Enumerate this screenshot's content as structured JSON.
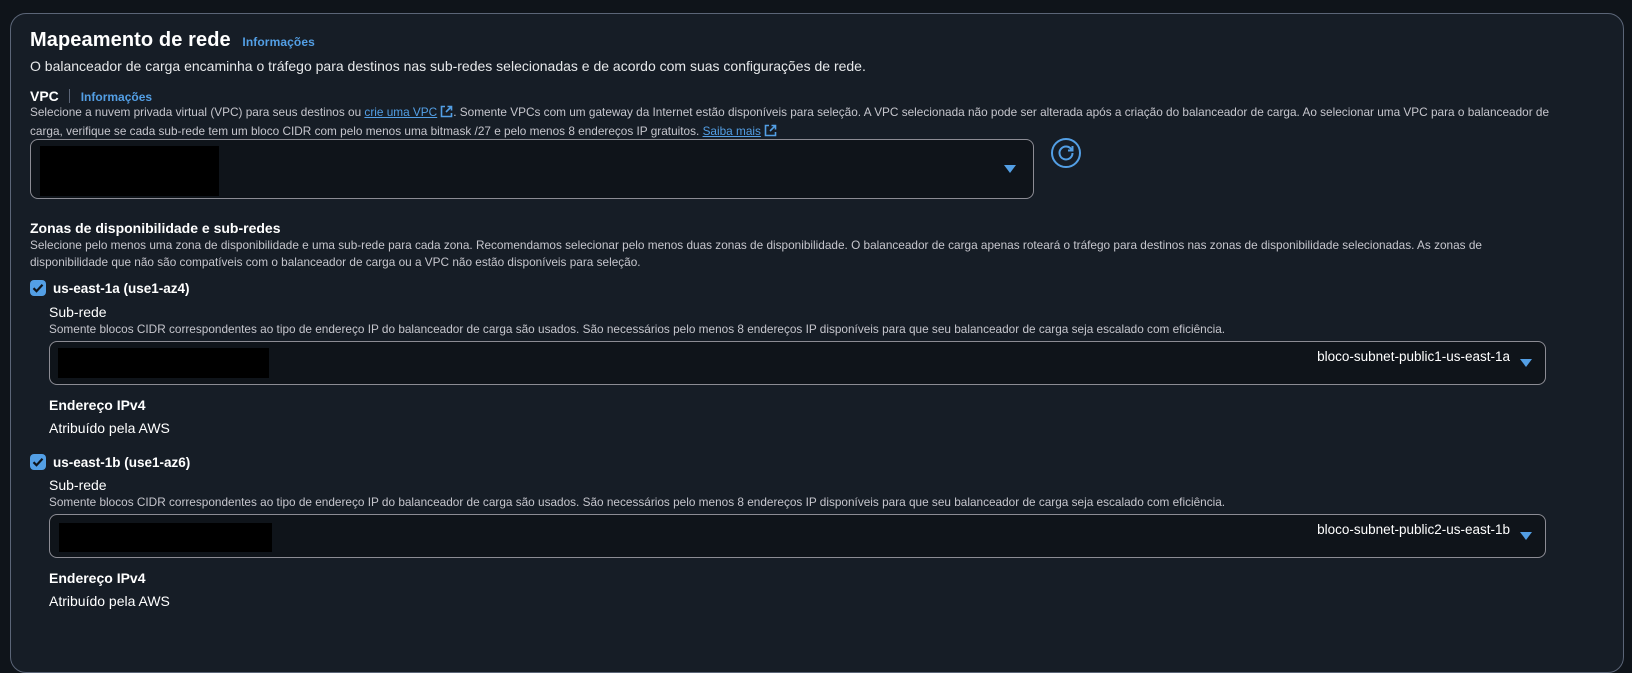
{
  "section": {
    "title": "Mapeamento de rede",
    "info_link": "Informações",
    "description": "O balanceador de carga encaminha o tráfego para destinos nas sub-redes selecionadas e de acordo com suas configurações de rede."
  },
  "vpc": {
    "label": "VPC",
    "info_link": "Informações",
    "help_part1": "Selecione a nuvem privada virtual (VPC) para seus destinos ou ",
    "create_link": "crie uma VPC",
    "help_part2": ". Somente VPCs com um gateway da Internet estão disponíveis para seleção. A VPC selecionada não pode ser alterada após a criação do balanceador de carga. Ao selecionar uma VPC para o balanceador de",
    "help_line2": "carga, verifique se cada sub-rede tem um bloco CIDR com pelo menos uma bitmask /27 e pelo menos 8 endereços IP gratuitos.",
    "learn_more_link": "Saiba mais"
  },
  "zones": {
    "label": "Zonas de disponibilidade e sub-redes",
    "help_line1": "Selecione pelo menos uma zona de disponibilidade e uma sub-rede para cada zona. Recomendamos selecionar pelo menos duas zonas de disponibilidade. O balanceador de carga apenas roteará o tráfego para destinos nas zonas de disponibilidade selecionadas. As zonas de",
    "help_line2": "disponibilidade que não são compatíveis com o balanceador de carga ou a VPC não estão disponíveis para seleção.",
    "items": [
      {
        "zone": "us-east-1a (use1-az4)",
        "checked": true,
        "subnet_label": "Sub-rede",
        "subnet_help": "Somente blocos CIDR correspondentes ao tipo de endereço IP do balanceador de carga são usados. São necessários pelo menos 8 endereços IP disponíveis para que seu balanceador de carga seja escalado com eficiência.",
        "subnet_name": "bloco-subnet-public1-us-east-1a",
        "ipv4_label": "Endereço IPv4",
        "ipv4_value": "Atribuído pela AWS"
      },
      {
        "zone": "us-east-1b (use1-az6)",
        "checked": true,
        "subnet_label": "Sub-rede",
        "subnet_help": "Somente blocos CIDR correspondentes ao tipo de endereço IP do balanceador de carga são usados. São necessários pelo menos 8 endereços IP disponíveis para que seu balanceador de carga seja escalado com eficiência.",
        "subnet_name": "bloco-subnet-public2-us-east-1b",
        "ipv4_label": "Endereço IPv4",
        "ipv4_value": "Atribuído pela AWS"
      }
    ]
  },
  "colors": {
    "accent": "#539fe5",
    "background": "#161d26",
    "border": "#5b6577"
  }
}
